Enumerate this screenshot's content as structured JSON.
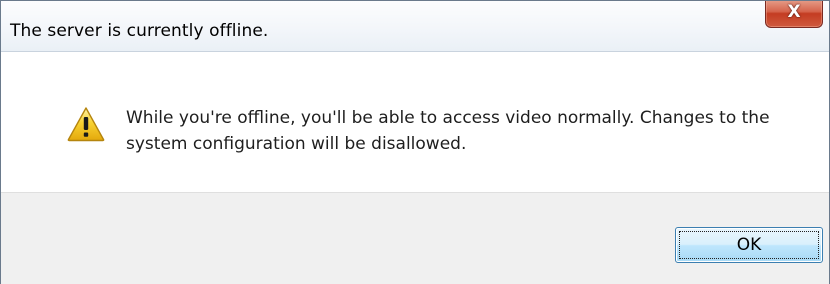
{
  "window": {
    "title": "The server is currently offline.",
    "close_glyph": "X"
  },
  "message": {
    "icon": "warning-icon",
    "text": "While you're offline, you'll be able to access video normally. Changes to the system configuration will be disallowed."
  },
  "buttons": {
    "ok_label": "OK"
  },
  "colors": {
    "close_button": "#c43c22",
    "warning_yellow": "#f5c518",
    "ok_border": "#3c7fb1",
    "footer_bg": "#f0f0f0"
  }
}
